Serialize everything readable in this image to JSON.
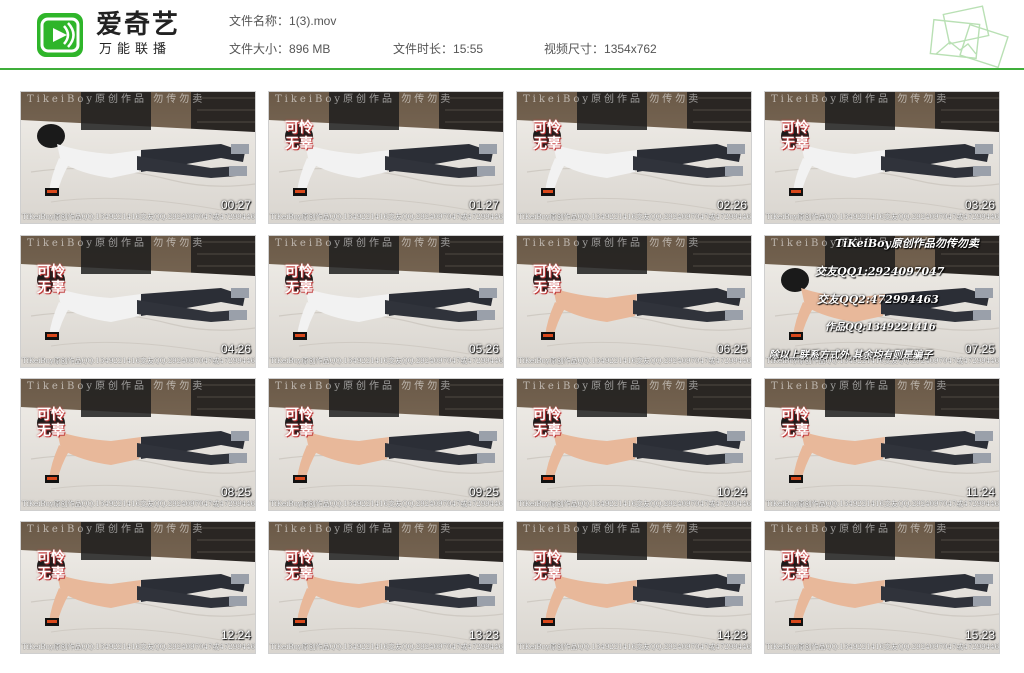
{
  "brand": {
    "title": "爱奇艺",
    "subtitle": "万能联播",
    "icon": "iqiyi-logo-icon",
    "accent": "#2fb52a"
  },
  "file_info": {
    "name_label": "文件名称：",
    "name_value": "1(3).mov",
    "size_label": "文件大小：",
    "size_value": "896 MB",
    "duration_label": "文件时长：",
    "duration_value": "15:55",
    "dimensions_label": "视频尺寸：",
    "dimensions_value": "1354x762"
  },
  "watermarks": {
    "top": "TikeiBoy原创作品 勿传勿卖",
    "bottom": "TiKeiBoy原创作品QQ:1349221416交友QQ:2924097047或472994463",
    "tag": "可怜 无辜",
    "qq_faint": "QQ 1349221416"
  },
  "overlay_thumb8": {
    "line1": "TiKeiBoy原创作品勿传勿卖",
    "line2": "交友QQ1:2924097047",
    "line3": "交友QQ2:472994463",
    "line4": "作品QQ:1349221416",
    "line5": "除以上联系方式外,其余均有则是骗子"
  },
  "thumbnails": [
    {
      "timestamp": "00:27",
      "variant": "clothed"
    },
    {
      "timestamp": "01:27",
      "variant": "clothed"
    },
    {
      "timestamp": "02:26",
      "variant": "clothed"
    },
    {
      "timestamp": "03:26",
      "variant": "clothed"
    },
    {
      "timestamp": "04:26",
      "variant": "clothed"
    },
    {
      "timestamp": "05:26",
      "variant": "clothed"
    },
    {
      "timestamp": "06:25",
      "variant": "shirtless"
    },
    {
      "timestamp": "07:25",
      "variant": "shirtless"
    },
    {
      "timestamp": "08:25",
      "variant": "shirtless"
    },
    {
      "timestamp": "09:25",
      "variant": "shirtless"
    },
    {
      "timestamp": "10:24",
      "variant": "shirtless"
    },
    {
      "timestamp": "11:24",
      "variant": "shirtless"
    },
    {
      "timestamp": "12:24",
      "variant": "shirtless"
    },
    {
      "timestamp": "13:23",
      "variant": "shirtless"
    },
    {
      "timestamp": "14:23",
      "variant": "shirtless"
    },
    {
      "timestamp": "15:23",
      "variant": "shirtless"
    }
  ]
}
